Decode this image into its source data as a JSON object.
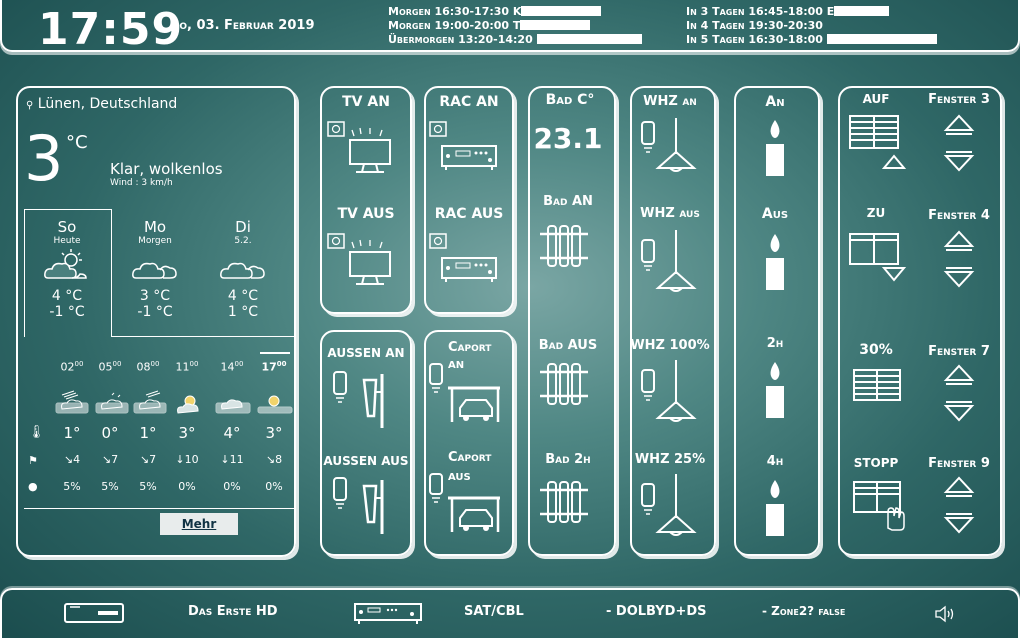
{
  "header": {
    "time": "17:59",
    "date": "So, 03. Februar 2019",
    "appointments_left": [
      "Morgen 16:30-17:30 K",
      "Morgen 19:00-20:00 T",
      "Übermorgen 13:20-14:20"
    ],
    "appointments_right": [
      "In 3 Tagen 16:45-18:00 E",
      "In 4 Tagen 19:30-20:30",
      "In 5 Tagen 16:30-18:00"
    ]
  },
  "weather": {
    "location": "Lünen, Deutschland",
    "temp": "3",
    "unit": "°C",
    "condition": "Klar, wolkenlos",
    "wind": "Wind : 3 km/h",
    "days": [
      {
        "name": "So",
        "sub": "Heute",
        "high": "4 °C",
        "low": "-1 °C"
      },
      {
        "name": "Mo",
        "sub": "Morgen",
        "high": "3 °C",
        "low": "-1 °C"
      },
      {
        "name": "Di",
        "sub": "5.2.",
        "high": "4 °C",
        "low": "1 °C"
      }
    ],
    "hours": [
      "02",
      "05",
      "08",
      "11",
      "14",
      "17"
    ],
    "hour_sup": "00",
    "temps": [
      "1°",
      "0°",
      "1°",
      "3°",
      "4°",
      "3°"
    ],
    "winds": [
      "4",
      "7",
      "7",
      "10",
      "11",
      "8"
    ],
    "rain": [
      "5%",
      "5%",
      "5%",
      "0%",
      "0%",
      "0%"
    ],
    "more_label": "Mehr"
  },
  "tv": {
    "on": "TV AN",
    "off": "TV AUS"
  },
  "rac": {
    "on": "RAC AN",
    "off": "RAC AUS"
  },
  "aussen": {
    "on": "AUSSEN AN",
    "off": "AUSSEN AUS"
  },
  "caport": {
    "on_1": "Caport",
    "on_2": "AN",
    "off_1": "Caport",
    "off_2": "AUS"
  },
  "bad": {
    "title": "Bad C°",
    "value": "23.1",
    "on": "Bad AN",
    "off": "Bad AUS",
    "two_h": "Bad 2h"
  },
  "whz": {
    "on": "WHZ an",
    "off": "WHZ aus",
    "full": "WHZ 100%",
    "quarter": "WHZ 25%"
  },
  "candle": {
    "on": "An",
    "off": "Aus",
    "two": "2h",
    "four": "4h"
  },
  "blinds": {
    "auf": "AUF",
    "zu": "ZU",
    "pct": "30%",
    "stopp": "STOPP",
    "f3": "Fenster 3",
    "f4": "Fenster 4",
    "f7": "Fenster 7",
    "f9": "Fenster 9"
  },
  "footer": {
    "channel": "Das Erste HD",
    "source": "SAT/CBL",
    "sound": "- DOLBYD+DS",
    "zone": "- Zone2? false"
  }
}
